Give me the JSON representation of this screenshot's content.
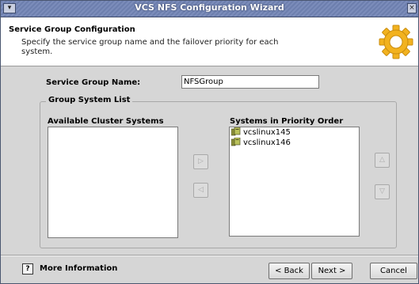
{
  "window": {
    "title": "VCS NFS Configuration Wizard",
    "menu_icon": "chevron-down-icon",
    "close_icon": "close-icon"
  },
  "header": {
    "title": "Service Group Configuration",
    "description": "Specify the service group name and the failover priority for each system.",
    "icon": "gear-icon"
  },
  "service_group": {
    "label": "Service Group Name:",
    "value": "NFSGroup"
  },
  "group_system_list": {
    "title": "Group System List",
    "available": {
      "label": "Available Cluster Systems",
      "items": []
    },
    "priority": {
      "label": "Systems in Priority Order",
      "items": [
        {
          "name": "vcslinux145",
          "icon": "system-icon"
        },
        {
          "name": "vcslinux146",
          "icon": "system-icon"
        }
      ]
    },
    "buttons": {
      "move_right": "▷",
      "move_left": "◁",
      "move_up": "△",
      "move_down": "▽"
    }
  },
  "footer": {
    "more_info": "More Information",
    "help_glyph": "?",
    "back": "< Back",
    "next": "Next >",
    "cancel": "Cancel"
  },
  "colors": {
    "titlebar": "#6d7fae",
    "header_bg": "#ffffff",
    "window_bg": "#d6d6d6",
    "gear": "#f2b21f"
  }
}
